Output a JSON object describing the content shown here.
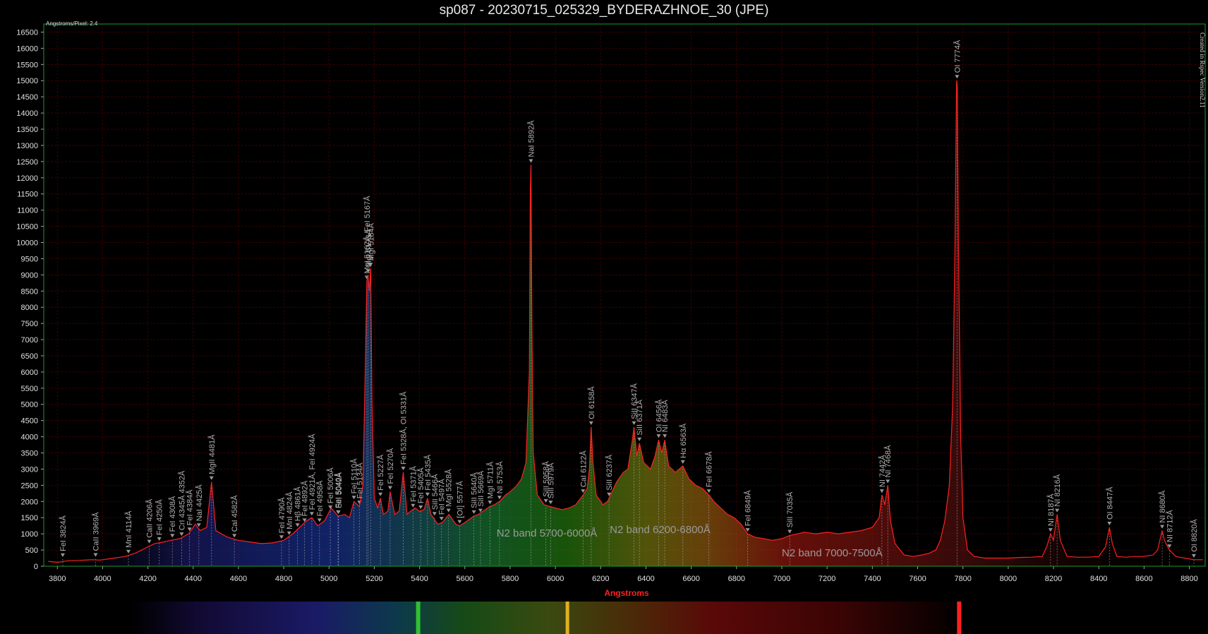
{
  "title": "sp087 - 20230715_025329_BYDERAZHNOE_30 (JPE)",
  "corner_text": "Angstroms/Pixel: 2.4",
  "side_text": "Created in Rspec Version2.11",
  "colors": {
    "background": "#000000",
    "grid": "#3a0000",
    "line": "#ff2020",
    "frame": "#1c9a2a",
    "axis_label": "#ff2020"
  },
  "chart_data": {
    "type": "line",
    "title": "sp087 - 20230715_025329_BYDERAZHNOE_30 (JPE)",
    "xlabel": "Angstroms",
    "ylabel": "",
    "xlim": [
      3740,
      8870
    ],
    "ylim": [
      0,
      16750
    ],
    "x_ticks": [
      3800,
      4000,
      4200,
      4400,
      4600,
      4800,
      5000,
      5200,
      5400,
      5600,
      5800,
      6000,
      6200,
      6400,
      6600,
      6800,
      7000,
      7200,
      7400,
      7600,
      7800,
      8000,
      8200,
      8400,
      8600,
      8800
    ],
    "y_ticks": [
      0,
      500,
      1000,
      1500,
      2000,
      2500,
      3000,
      3500,
      4000,
      4500,
      5000,
      5500,
      6000,
      6500,
      7000,
      7500,
      8000,
      8500,
      9000,
      9500,
      10000,
      10500,
      11000,
      11500,
      12000,
      12500,
      13000,
      13500,
      14000,
      14500,
      15000,
      15500,
      16000,
      16500
    ],
    "grid": true,
    "series": [
      {
        "values": [
          [
            3760,
            150
          ],
          [
            3800,
            120
          ],
          [
            3850,
            170
          ],
          [
            3900,
            180
          ],
          [
            3950,
            200
          ],
          [
            3990,
            190
          ],
          [
            4050,
            250
          ],
          [
            4100,
            300
          ],
          [
            4150,
            420
          ],
          [
            4200,
            600
          ],
          [
            4230,
            700
          ],
          [
            4270,
            750
          ],
          [
            4300,
            800
          ],
          [
            4340,
            850
          ],
          [
            4380,
            1000
          ],
          [
            4410,
            1300
          ],
          [
            4430,
            1100
          ],
          [
            4460,
            1200
          ],
          [
            4481,
            2600
          ],
          [
            4500,
            1100
          ],
          [
            4550,
            900
          ],
          [
            4600,
            800
          ],
          [
            4650,
            750
          ],
          [
            4700,
            700
          ],
          [
            4750,
            720
          ],
          [
            4800,
            800
          ],
          [
            4840,
            1000
          ],
          [
            4870,
            1200
          ],
          [
            4900,
            1400
          ],
          [
            4924,
            1500
          ],
          [
            4950,
            1250
          ],
          [
            4980,
            1400
          ],
          [
            5010,
            1800
          ],
          [
            5040,
            1550
          ],
          [
            5070,
            1600
          ],
          [
            5090,
            1500
          ],
          [
            5110,
            2000
          ],
          [
            5134,
            1850
          ],
          [
            5150,
            2500
          ],
          [
            5160,
            6000
          ],
          [
            5167,
            8800
          ],
          [
            5172,
            9000
          ],
          [
            5178,
            8500
          ],
          [
            5184,
            9200
          ],
          [
            5190,
            5000
          ],
          [
            5200,
            2100
          ],
          [
            5215,
            1800
          ],
          [
            5227,
            2100
          ],
          [
            5240,
            1600
          ],
          [
            5260,
            1700
          ],
          [
            5270,
            2300
          ],
          [
            5290,
            1600
          ],
          [
            5310,
            1700
          ],
          [
            5328,
            2900
          ],
          [
            5345,
            1600
          ],
          [
            5360,
            1700
          ],
          [
            5380,
            1800
          ],
          [
            5400,
            1700
          ],
          [
            5420,
            1750
          ],
          [
            5435,
            2100
          ],
          [
            5450,
            1600
          ],
          [
            5480,
            1300
          ],
          [
            5500,
            1350
          ],
          [
            5530,
            1600
          ],
          [
            5560,
            1300
          ],
          [
            5577,
            1250
          ],
          [
            5600,
            1350
          ],
          [
            5620,
            1450
          ],
          [
            5640,
            1550
          ],
          [
            5660,
            1600
          ],
          [
            5690,
            1750
          ],
          [
            5711,
            1850
          ],
          [
            5730,
            1900
          ],
          [
            5753,
            2000
          ],
          [
            5780,
            2200
          ],
          [
            5800,
            2300
          ],
          [
            5830,
            2500
          ],
          [
            5850,
            2700
          ],
          [
            5870,
            3200
          ],
          [
            5885,
            6000
          ],
          [
            5889,
            11500
          ],
          [
            5892,
            12400
          ],
          [
            5896,
            7500
          ],
          [
            5902,
            3500
          ],
          [
            5920,
            2200
          ],
          [
            5950,
            1900
          ],
          [
            5975,
            1850
          ],
          [
            6000,
            1800
          ],
          [
            6030,
            1750
          ],
          [
            6060,
            1800
          ],
          [
            6090,
            1900
          ],
          [
            6122,
            2200
          ],
          [
            6140,
            2400
          ],
          [
            6150,
            3000
          ],
          [
            6158,
            4300
          ],
          [
            6166,
            3200
          ],
          [
            6180,
            2200
          ],
          [
            6210,
            1900
          ],
          [
            6230,
            2000
          ],
          [
            6250,
            2300
          ],
          [
            6270,
            2600
          ],
          [
            6300,
            2900
          ],
          [
            6320,
            3000
          ],
          [
            6340,
            3900
          ],
          [
            6347,
            4300
          ],
          [
            6360,
            3400
          ],
          [
            6371,
            3800
          ],
          [
            6390,
            3200
          ],
          [
            6420,
            3000
          ],
          [
            6440,
            3400
          ],
          [
            6456,
            3900
          ],
          [
            6470,
            3500
          ],
          [
            6483,
            3900
          ],
          [
            6500,
            3100
          ],
          [
            6530,
            2900
          ],
          [
            6563,
            3100
          ],
          [
            6590,
            2700
          ],
          [
            6620,
            2500
          ],
          [
            6650,
            2400
          ],
          [
            6678,
            2200
          ],
          [
            6700,
            2000
          ],
          [
            6730,
            1800
          ],
          [
            6760,
            1600
          ],
          [
            6790,
            1500
          ],
          [
            6820,
            1300
          ],
          [
            6849,
            1000
          ],
          [
            6880,
            900
          ],
          [
            6920,
            850
          ],
          [
            6960,
            800
          ],
          [
            7000,
            850
          ],
          [
            7035,
            950
          ],
          [
            7070,
            1000
          ],
          [
            7100,
            1050
          ],
          [
            7150,
            1000
          ],
          [
            7200,
            1050
          ],
          [
            7250,
            1000
          ],
          [
            7300,
            1050
          ],
          [
            7350,
            1100
          ],
          [
            7400,
            1200
          ],
          [
            7430,
            1500
          ],
          [
            7442,
            2200
          ],
          [
            7455,
            1900
          ],
          [
            7468,
            2500
          ],
          [
            7480,
            1400
          ],
          [
            7500,
            700
          ],
          [
            7540,
            350
          ],
          [
            7580,
            300
          ],
          [
            7620,
            350
          ],
          [
            7650,
            400
          ],
          [
            7680,
            500
          ],
          [
            7700,
            800
          ],
          [
            7720,
            1400
          ],
          [
            7740,
            2500
          ],
          [
            7755,
            5000
          ],
          [
            7765,
            10000
          ],
          [
            7772,
            15000
          ],
          [
            7775,
            14800
          ],
          [
            7780,
            10000
          ],
          [
            7790,
            4000
          ],
          [
            7800,
            1500
          ],
          [
            7820,
            500
          ],
          [
            7850,
            300
          ],
          [
            7900,
            250
          ],
          [
            7950,
            250
          ],
          [
            8000,
            250
          ],
          [
            8050,
            270
          ],
          [
            8100,
            280
          ],
          [
            8150,
            300
          ],
          [
            8170,
            600
          ],
          [
            8187,
            1000
          ],
          [
            8200,
            800
          ],
          [
            8216,
            1600
          ],
          [
            8230,
            800
          ],
          [
            8260,
            300
          ],
          [
            8300,
            280
          ],
          [
            8350,
            280
          ],
          [
            8400,
            300
          ],
          [
            8430,
            600
          ],
          [
            8447,
            1200
          ],
          [
            8460,
            700
          ],
          [
            8480,
            300
          ],
          [
            8520,
            280
          ],
          [
            8560,
            300
          ],
          [
            8600,
            300
          ],
          [
            8640,
            350
          ],
          [
            8660,
            500
          ],
          [
            8680,
            1100
          ],
          [
            8690,
            800
          ],
          [
            8712,
            500
          ],
          [
            8740,
            300
          ],
          [
            8780,
            250
          ],
          [
            8820,
            200
          ],
          [
            8860,
            200
          ]
        ]
      }
    ],
    "lines": [
      {
        "label": "FeI 3824Å",
        "x": 3824,
        "y": 220
      },
      {
        "label": "CaII 3969Å",
        "x": 3969,
        "y": 230
      },
      {
        "label": "MnI 4114Å",
        "x": 4114,
        "y": 330
      },
      {
        "label": "CaII 4206Å",
        "x": 4206,
        "y": 640
      },
      {
        "label": "FeI 4250Å",
        "x": 4250,
        "y": 720
      },
      {
        "label": "FeI 4308Å",
        "x": 4308,
        "y": 820
      },
      {
        "label": "CrI 4345Å 4352Å",
        "x": 4349,
        "y": 870
      },
      {
        "label": "FeI 4384Å",
        "x": 4384,
        "y": 1020
      },
      {
        "label": "NaI 4425Å",
        "x": 4425,
        "y": 1150
      },
      {
        "label": "MgII 4481Å",
        "x": 4481,
        "y": 2600
      },
      {
        "label": "CaI 4582Å",
        "x": 4582,
        "y": 820
      },
      {
        "label": "FeI 4790Å",
        "x": 4790,
        "y": 780
      },
      {
        "label": "MnI 4824Å",
        "x": 4824,
        "y": 900
      },
      {
        "label": "Hβ 4861Å",
        "x": 4861,
        "y": 1150
      },
      {
        "label": "FeI 4892Å",
        "x": 4892,
        "y": 1300
      },
      {
        "label": "FeI 4921Å, FeI 4924Å",
        "x": 4924,
        "y": 1500
      },
      {
        "label": "FeI 4958Å",
        "x": 4958,
        "y": 1300
      },
      {
        "label": "FeI 5006Å",
        "x": 5006,
        "y": 1700
      },
      {
        "label": "FeI 5040Å",
        "x": 5040,
        "y": 1550
      },
      {
        "label": "SiII 5042Å",
        "x": 5042,
        "y": 1550
      },
      {
        "label": "FeI 5110Å",
        "x": 5110,
        "y": 2000
      },
      {
        "label": "FeI 5134Å",
        "x": 5134,
        "y": 1850
      },
      {
        "label": "MgI 5167Å, FeI 5167Å",
        "x": 5167,
        "y": 8800
      },
      {
        "label": "MgI 5173Å",
        "x": 5173,
        "y": 9000
      },
      {
        "label": "MgI 5184Å",
        "x": 5184,
        "y": 9200
      },
      {
        "label": "FeI 5227Å",
        "x": 5227,
        "y": 2100
      },
      {
        "label": "FeI 5270Å",
        "x": 5270,
        "y": 2300
      },
      {
        "label": "FeI 5328Å, OI 5331Å",
        "x": 5328,
        "y": 2900
      },
      {
        "label": "FeI 5371Å",
        "x": 5371,
        "y": 1750
      },
      {
        "label": "FeI 5405Å",
        "x": 5405,
        "y": 1700
      },
      {
        "label": "FeI 5435Å",
        "x": 5435,
        "y": 2100
      },
      {
        "label": "SiII 5466Å",
        "x": 5466,
        "y": 1500
      },
      {
        "label": "FeI 5497Å",
        "x": 5497,
        "y": 1350
      },
      {
        "label": "MgI 5528Å",
        "x": 5528,
        "y": 1600
      },
      {
        "label": "[OI] 5577Å",
        "x": 5577,
        "y": 1250
      },
      {
        "label": "SiII 5640Å",
        "x": 5640,
        "y": 1550
      },
      {
        "label": "SiII 5669Å",
        "x": 5669,
        "y": 1600
      },
      {
        "label": "MgI 5711Å",
        "x": 5711,
        "y": 1850
      },
      {
        "label": "NI 5753Å",
        "x": 5753,
        "y": 2000
      },
      {
        "label": "NaI 5892Å",
        "x": 5892,
        "y": 12400
      },
      {
        "label": "SiII 5958Å",
        "x": 5958,
        "y": 1900
      },
      {
        "label": "SiII 5979Å",
        "x": 5979,
        "y": 1850
      },
      {
        "label": "CaI 6122Å",
        "x": 6122,
        "y": 2200
      },
      {
        "label": "OI 6158Å",
        "x": 6158,
        "y": 4300
      },
      {
        "label": "SiII 6237Å",
        "x": 6237,
        "y": 2100
      },
      {
        "label": "SiII 6347Å",
        "x": 6347,
        "y": 4300
      },
      {
        "label": "SiII 6371Å",
        "x": 6371,
        "y": 3800
      },
      {
        "label": "OI 6456Å",
        "x": 6456,
        "y": 3900
      },
      {
        "label": "NI 6483Å",
        "x": 6483,
        "y": 3900
      },
      {
        "label": "Hα 6563Å",
        "x": 6563,
        "y": 3100
      },
      {
        "label": "FeI 6678Å",
        "x": 6678,
        "y": 2200
      },
      {
        "label": "FeI 6849Å",
        "x": 6849,
        "y": 1000
      },
      {
        "label": "SiII 7035Å",
        "x": 7035,
        "y": 950
      },
      {
        "label": "NI 7442Å",
        "x": 7442,
        "y": 2200
      },
      {
        "label": "NI 7468Å",
        "x": 7468,
        "y": 2500
      },
      {
        "label": "OI 7774Å",
        "x": 7774,
        "y": 15000
      },
      {
        "label": "NI 8187Å",
        "x": 8187,
        "y": 1000
      },
      {
        "label": "NI 8216Å",
        "x": 8216,
        "y": 1600
      },
      {
        "label": "OI 8447Å",
        "x": 8447,
        "y": 1200
      },
      {
        "label": "NI 8680Å",
        "x": 8680,
        "y": 1100
      },
      {
        "label": "NI 8712Å",
        "x": 8712,
        "y": 500
      },
      {
        "label": "OI 8820Å",
        "x": 8820,
        "y": 200
      }
    ],
    "annotations": [
      {
        "text": "N2 band 5700-6000Å",
        "x": 5740,
        "y": 920
      },
      {
        "text": "N2 band 6200-6800Å",
        "x": 6240,
        "y": 1030
      },
      {
        "text": "N2 band 7000-7500Å",
        "x": 7000,
        "y": 310
      }
    ]
  }
}
